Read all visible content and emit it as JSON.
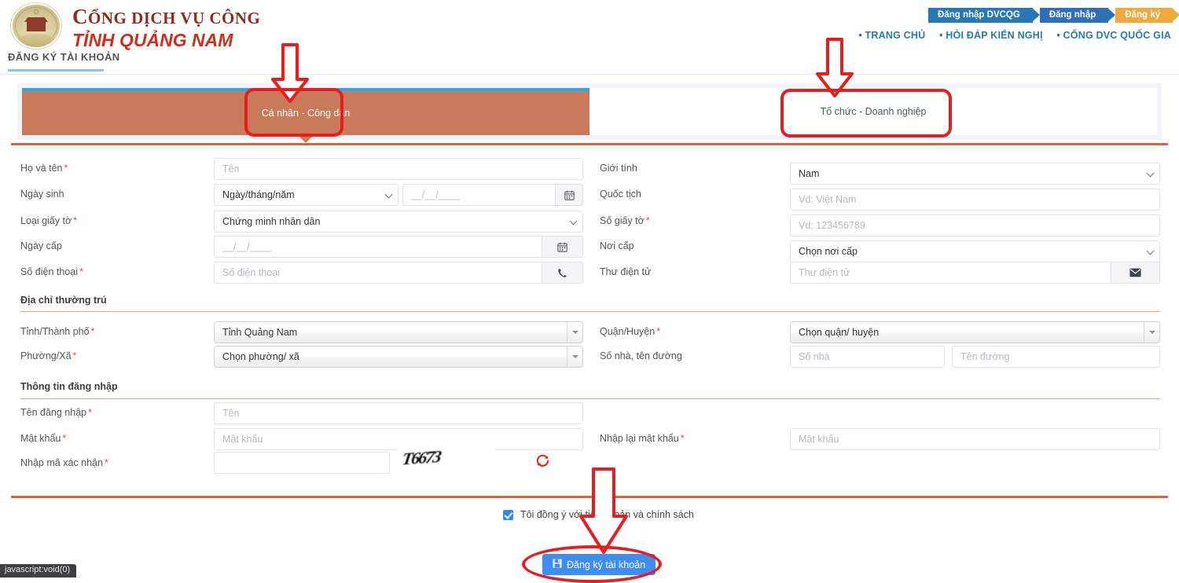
{
  "header": {
    "brand_line1": "CỔNG DỊCH VỤ CÔNG",
    "brand_line1_cap": "C",
    "brand_line1_rest": "ỔNG DỊCH VỤ CÔNG",
    "brand_line2": "TỈNH QUẢNG NAM",
    "page_title": "ĐĂNG KÝ TÀI KHOẢN",
    "chevrons": [
      {
        "label": "Đăng nhập DVCQG",
        "color": "#2878b5"
      },
      {
        "label": "Đăng nhập",
        "color": "#2e6fb7"
      },
      {
        "label": "Đăng ký",
        "color": "#f0a93b"
      }
    ],
    "links": [
      "• TRANG CHỦ",
      "• HỎI ĐÁP KIẾN NGHỊ",
      "• CỔNG DVC QUỐC GIA"
    ]
  },
  "tabs": [
    {
      "label": "Cá nhân - Công dân",
      "active": true
    },
    {
      "label": "Tổ chức - Doanh nghiệp",
      "active": false
    }
  ],
  "form": {
    "fullname": {
      "label": "Họ và tên",
      "required": true,
      "placeholder": "Tên",
      "value": ""
    },
    "gender": {
      "label": "Giới tính",
      "required": false,
      "value": "Nam"
    },
    "birthdate": {
      "label": "Ngày sinh",
      "required": false,
      "format_value": "Ngày/tháng/năm",
      "placeholder": "__/__/____",
      "value": ""
    },
    "nationality": {
      "label": "Quốc tịch",
      "required": false,
      "placeholder": "Vd: Việt Nam",
      "value": ""
    },
    "doctype": {
      "label": "Loại giấy tờ",
      "required": true,
      "value": "Chứng minh nhân dân"
    },
    "docnumber": {
      "label": "Số giấy tờ",
      "required": true,
      "placeholder": "Vd: 123456789",
      "value": ""
    },
    "issuedate": {
      "label": "Ngày cấp",
      "required": false,
      "placeholder": "__/__/____",
      "value": ""
    },
    "issueplace": {
      "label": "Nơi cấp",
      "required": false,
      "value": "Chọn nơi cấp"
    },
    "phone": {
      "label": "Số điện thoại",
      "required": true,
      "placeholder": "Số điện thoại",
      "value": ""
    },
    "email": {
      "label": "Thư điện tử",
      "required": false,
      "placeholder": "Thư điện tử",
      "value": ""
    }
  },
  "address": {
    "title": "Địa chỉ thường trú",
    "province": {
      "label": "Tỉnh/Thành phố",
      "required": true,
      "value": "Tỉnh Quảng Nam"
    },
    "district": {
      "label": "Quận/Huyện",
      "required": true,
      "value": "Chọn quận/ huyện"
    },
    "ward": {
      "label": "Phường/Xã",
      "required": true,
      "value": "Chọn phường/ xã"
    },
    "street": {
      "label": "Số nhà, tên đường",
      "required": false,
      "house_placeholder": "Số nhà",
      "street_placeholder": "Tên đường",
      "house_value": "",
      "street_value": ""
    }
  },
  "login": {
    "title": "Thông tin đăng nhập",
    "username": {
      "label": "Tên đăng nhập",
      "required": true,
      "placeholder": "Tên",
      "value": ""
    },
    "password": {
      "label": "Mật khẩu",
      "required": true,
      "placeholder": "Mật khẩu",
      "value": ""
    },
    "password2": {
      "label": "Nhập lại mật khẩu",
      "required": true,
      "placeholder": "Mật khẩu",
      "value": ""
    },
    "captcha": {
      "label": "Nhập mã xác nhận",
      "required": true,
      "placeholder": "",
      "value": "",
      "image_text": "T6673",
      "refresh_icon": "refresh-icon"
    }
  },
  "footer": {
    "agree_label": "Tôi đồng ý với tiêu khoản và chính sách",
    "agree_checked": true,
    "submit_label": "Đăng ký tài khoản",
    "submit_icon": "save-icon"
  },
  "statusbar": {
    "text": "javascript:void(0)"
  },
  "icons": {
    "calendar": "📅",
    "phone": "📞",
    "envelope": "✉",
    "refresh": "⟳",
    "save": "💾"
  },
  "colors": {
    "accent_orange": "#d9643c",
    "tab_active": "#c87a5a",
    "tab_top_border": "#29abe2",
    "brand_red": "#cf2e1c",
    "brand_dark_red": "#8f2b20",
    "link_blue": "#2878b5",
    "button_blue": "#3d8ef0",
    "annotation_red": "#e81d1d",
    "required_red": "#e74c3c"
  }
}
